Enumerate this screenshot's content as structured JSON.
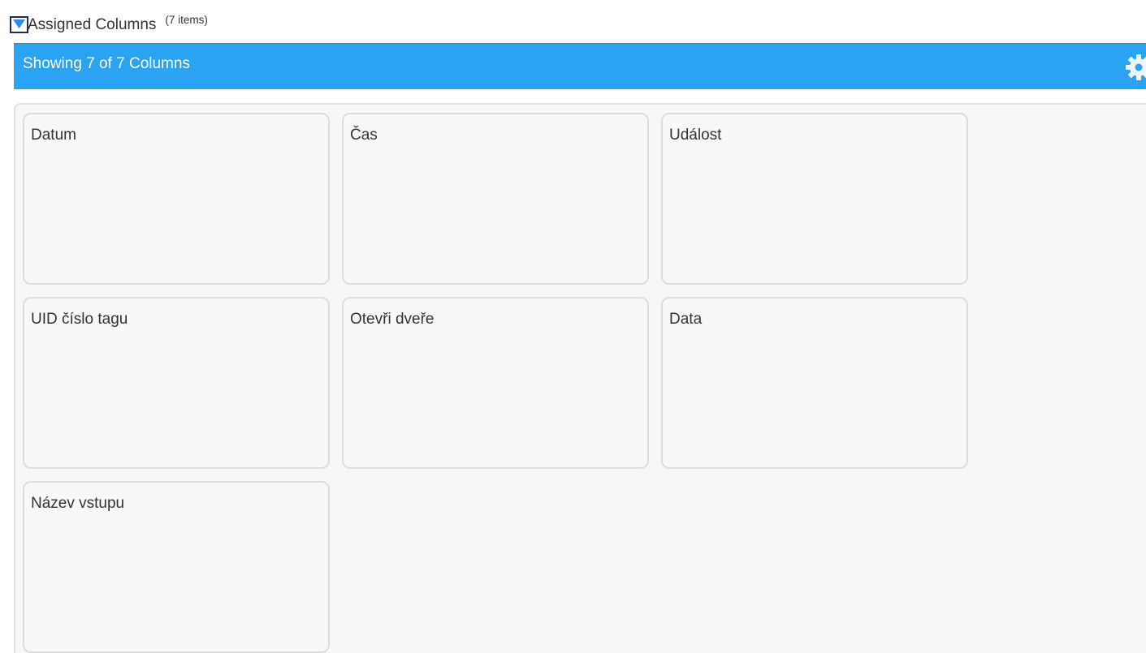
{
  "header": {
    "title": "Assigned Columns",
    "item_count": "(7 items)",
    "checkbox_checked": true,
    "checkbox_color": "#2b6cb0"
  },
  "bar": {
    "text": "Showing 7 of 7 Columns",
    "background": "#2ba3f3",
    "settings_icon": "gear-icon"
  },
  "cards": [
    {
      "label": "Datum"
    },
    {
      "label": "Čas"
    },
    {
      "label": "Událost"
    },
    {
      "label": "UID číslo tagu"
    },
    {
      "label": "Otevři dveře"
    },
    {
      "label": "Data"
    },
    {
      "label": "Název vstupu"
    }
  ]
}
